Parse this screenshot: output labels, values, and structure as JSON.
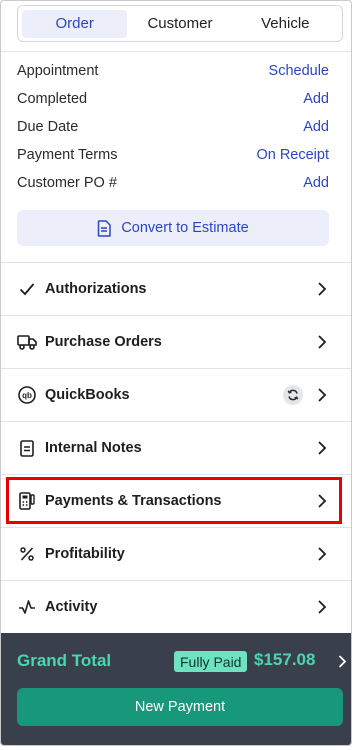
{
  "tabs": [
    {
      "label": "Order",
      "active": true
    },
    {
      "label": "Customer",
      "active": false
    },
    {
      "label": "Vehicle",
      "active": false
    }
  ],
  "info_rows": [
    {
      "label": "Appointment",
      "action": "Schedule"
    },
    {
      "label": "Completed",
      "action": "Add"
    },
    {
      "label": "Due Date",
      "action": "Add"
    },
    {
      "label": "Payment Terms",
      "action": "On Receipt"
    },
    {
      "label": "Customer PO #",
      "action": "Add"
    }
  ],
  "convert_button": {
    "label": "Convert to Estimate",
    "icon": "document-icon"
  },
  "nav_items": [
    {
      "label": "Authorizations",
      "icon": "checkmark-icon"
    },
    {
      "label": "Purchase Orders",
      "icon": "truck-icon"
    },
    {
      "label": "QuickBooks",
      "icon": "quickbooks-icon",
      "badge_icon": "sync-icon"
    },
    {
      "label": "Internal Notes",
      "icon": "notes-icon"
    },
    {
      "label": "Payments & Transactions",
      "icon": "payment-terminal-icon",
      "highlighted": true
    },
    {
      "label": "Profitability",
      "icon": "percent-icon"
    },
    {
      "label": "Activity",
      "icon": "activity-icon"
    }
  ],
  "footer": {
    "grand_total_label": "Grand Total",
    "status_badge": "Fully Paid",
    "amount": "$157.08",
    "new_payment_label": "New Payment"
  },
  "colors": {
    "accent_blue": "#2b46c2",
    "tab_active_bg": "#eceff9",
    "footer_bg": "#3a3f4c",
    "total_text": "#49d6b0",
    "badge_bg": "#6fe3c1",
    "primary_button": "#17987a",
    "highlight_border": "#e60000"
  }
}
